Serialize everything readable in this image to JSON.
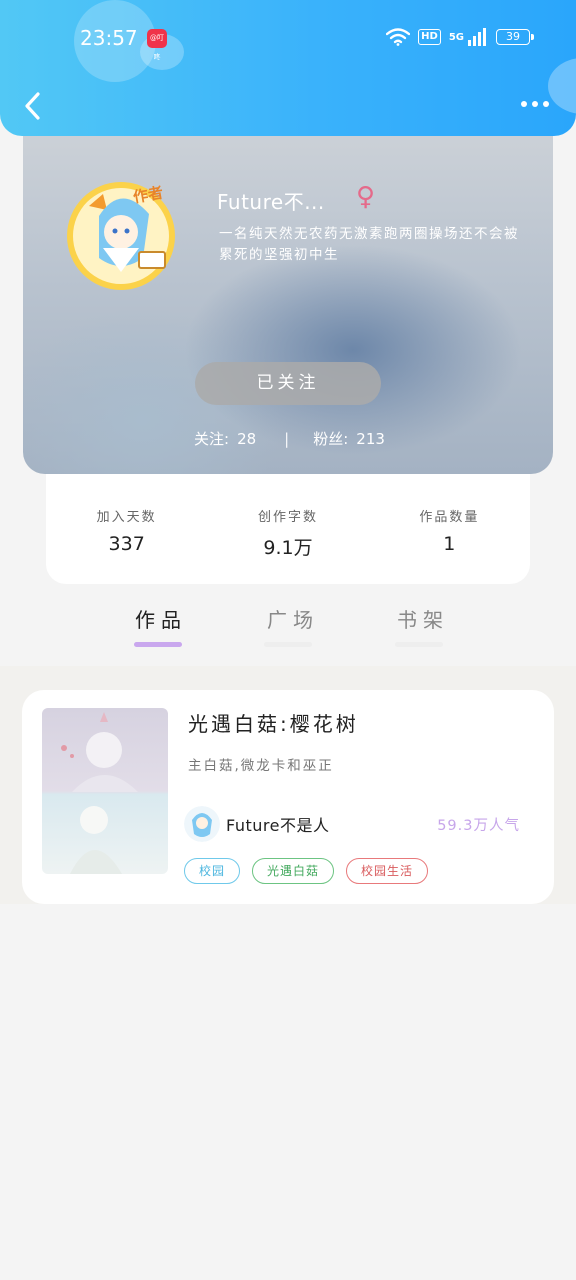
{
  "status_bar": {
    "time": "23:57",
    "app_badge": "@叮咚",
    "hd": "HD",
    "network": "5G",
    "battery": "39"
  },
  "nav": {
    "back_icon": "chevron-left-icon",
    "more_icon": "more-dots-icon"
  },
  "profile": {
    "author_badge": "作者",
    "nickname": "Future不...",
    "gender_symbol": "♀",
    "gender_color": "#e56a8a",
    "bio": "一名纯天然无农药无激素跑两圈操场还不会被累死的坚强初中生",
    "follow_button": "已关注",
    "following_label": "关注:",
    "following_count": "28",
    "separator": "|",
    "fans_label": "粉丝:",
    "fans_count": "213"
  },
  "stats": [
    {
      "label": "加入天数",
      "value": "337"
    },
    {
      "label": "创作字数",
      "value": "9.1万"
    },
    {
      "label": "作品数量",
      "value": "1"
    }
  ],
  "tabs": [
    {
      "label": "作品",
      "active": true
    },
    {
      "label": "广场",
      "active": false
    },
    {
      "label": "书架",
      "active": false
    }
  ],
  "works": [
    {
      "title": "光遇白菇:樱花树",
      "description": "主白菇,微龙卡和巫正",
      "author": "Future不是人",
      "popularity": "59.3万人气",
      "tags": [
        "校园",
        "光遇白菇",
        "校园生活"
      ]
    }
  ],
  "colors": {
    "header_start": "#52c8f5",
    "header_end": "#2aa6fb",
    "tab_active_indicator": "#c9a7ee",
    "popularity": "#c7a6ea"
  }
}
